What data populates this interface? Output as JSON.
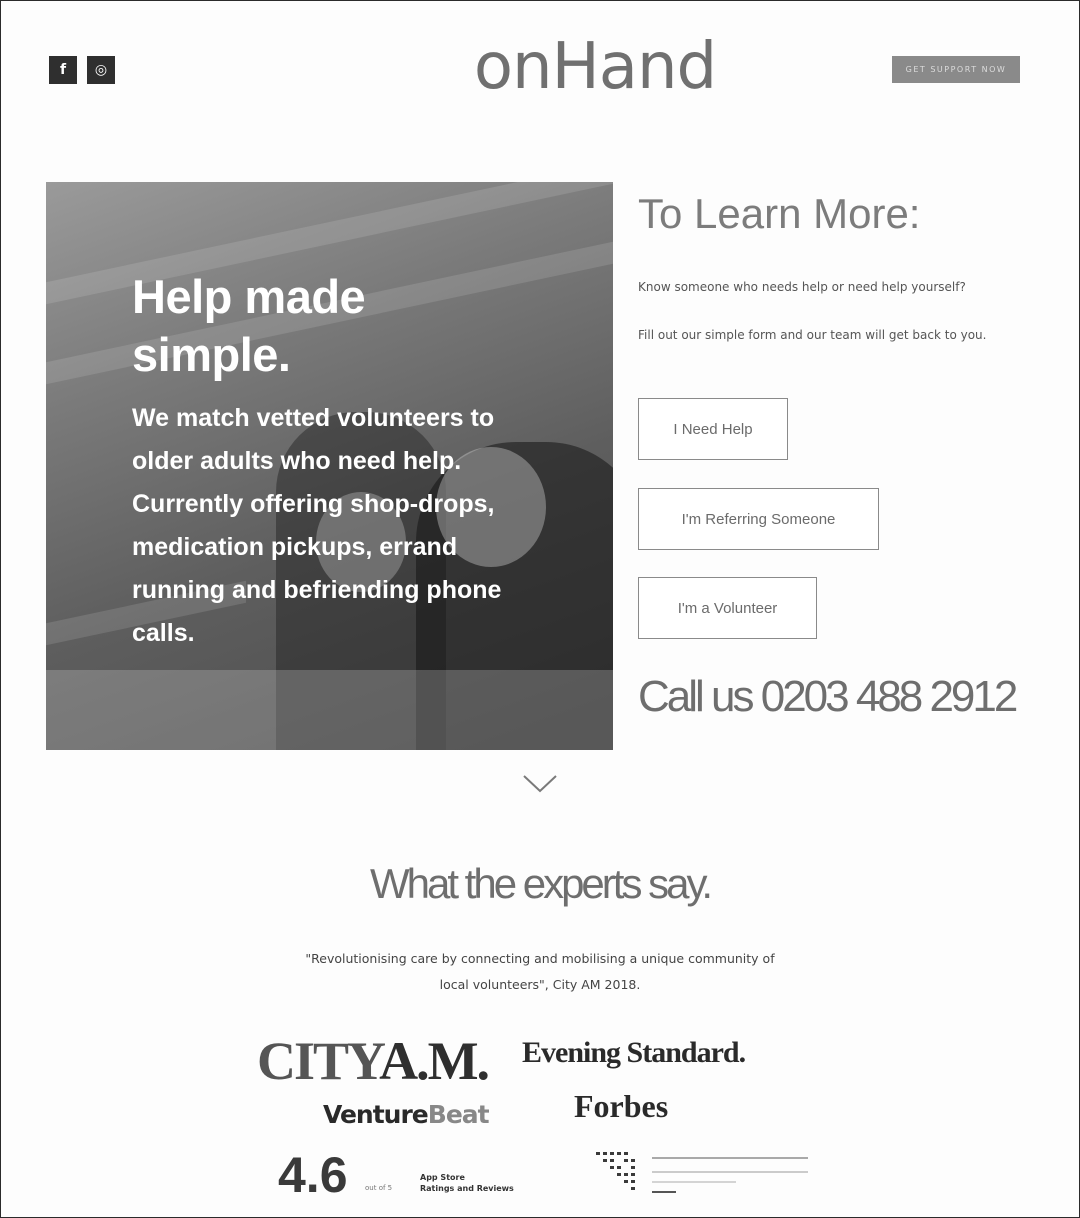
{
  "header": {
    "logo": "onHand",
    "social": [
      {
        "icon": "facebook-icon",
        "glyph": "f"
      },
      {
        "icon": "instagram-icon",
        "glyph": "◎"
      }
    ],
    "top_button_label": "GET SUPPORT NOW"
  },
  "hero": {
    "title": "Help made simple.",
    "body": "We  match vetted volunteers to older adults who need help. Currently offering shop-drops, medication pickups, errand running and befriending phone calls."
  },
  "learn": {
    "title": "To Learn More:",
    "p1": "Know someone who needs help or need help yourself?",
    "p2": "Fill out our simple form and our team will  get back to you.",
    "buttons": [
      "I Need Help",
      "I'm Referring Someone",
      "I'm a Volunteer"
    ],
    "call": "Call us 0203 488 2912"
  },
  "experts": {
    "title": "What the experts say.",
    "quote": "\"Revolutionising  care by connecting and mobilising a unique community  of local volunteers\",",
    "source": "City AM 2018."
  },
  "press": {
    "cityam_city": "CITY",
    "cityam_am": "A.M.",
    "evening": "Evening Standard.",
    "venture_a": "Venture",
    "venture_b": "Beat",
    "forbes": "Forbes",
    "rating": "4.6",
    "rating_sub": "out of 5",
    "app_line1": "App Store",
    "app_line2": "Ratings and Reviews"
  }
}
